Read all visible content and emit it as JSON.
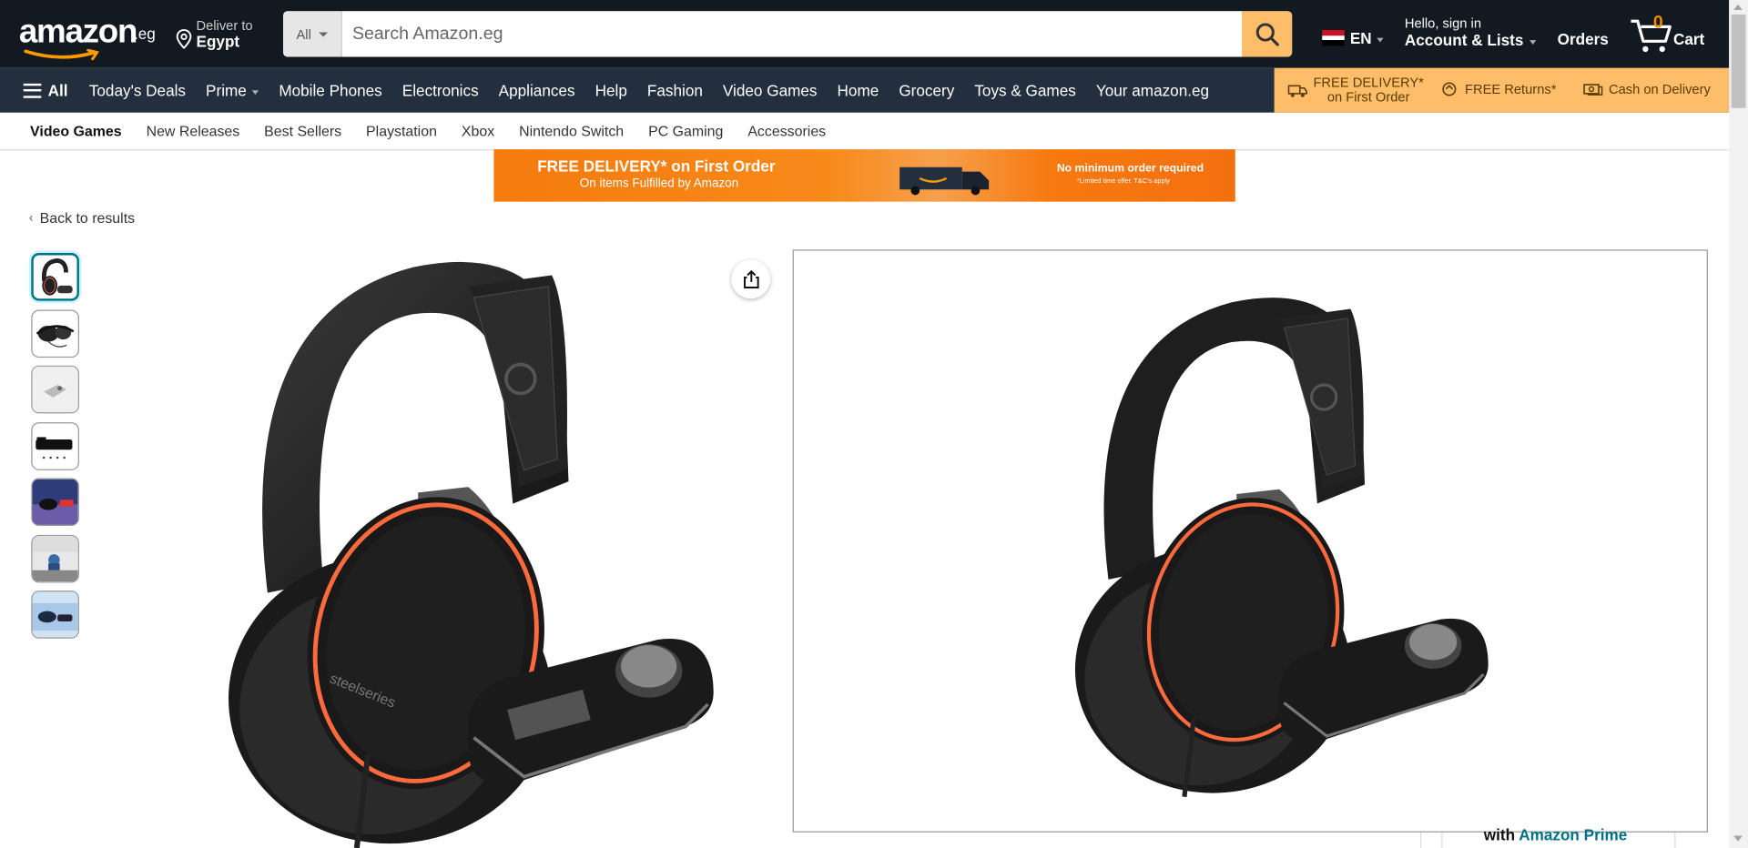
{
  "header": {
    "logo_text": "amazon",
    "logo_suffix": ".eg",
    "deliver_line1": "Deliver to",
    "deliver_line2": "Egypt",
    "search": {
      "category": "All",
      "placeholder": "Search Amazon.eg",
      "value": ""
    },
    "language": "EN",
    "account_line1": "Hello, sign in",
    "account_line2": "Account & Lists",
    "orders": "Orders",
    "cart_count": "0",
    "cart_label": "Cart",
    "colors": {
      "bg": "#131921",
      "search_button": "#febd69",
      "cart_count": "#f08804"
    }
  },
  "nav": {
    "all_label": "All",
    "items": [
      {
        "label": "Today's Deals"
      },
      {
        "label": "Prime",
        "has_caret": true
      },
      {
        "label": "Mobile Phones"
      },
      {
        "label": "Electronics"
      },
      {
        "label": "Appliances"
      },
      {
        "label": "Help"
      },
      {
        "label": "Fashion"
      },
      {
        "label": "Video Games"
      },
      {
        "label": "Home"
      },
      {
        "label": "Grocery"
      },
      {
        "label": "Toys & Games"
      },
      {
        "label": "Your amazon.eg"
      }
    ],
    "promo": {
      "free_delivery_line1": "FREE DELIVERY*",
      "free_delivery_line2": "on First Order",
      "free_returns": "FREE Returns*",
      "cash_on_delivery": "Cash on Delivery"
    }
  },
  "subnav": {
    "items": [
      "Video Games",
      "New Releases",
      "Best Sellers",
      "Playstation",
      "Xbox",
      "Nintendo Switch",
      "PC Gaming",
      "Accessories"
    ]
  },
  "banner": {
    "title": "FREE DELIVERY* on First Order",
    "subtitle": "On items Fulfilled by Amazon",
    "right_title": "No minimum order required",
    "right_note": "*Limited time offer. T&C's apply"
  },
  "back_link": "Back to results",
  "product": {
    "thumbnails": [
      "thumbnail-1",
      "thumbnail-2",
      "thumbnail-3",
      "thumbnail-4",
      "thumbnail-5",
      "thumbnail-6",
      "thumbnail-7"
    ],
    "main_image": "gaming-headset-with-dac-image",
    "buy_with": "with",
    "buy_prime": "Amazon Prime"
  }
}
